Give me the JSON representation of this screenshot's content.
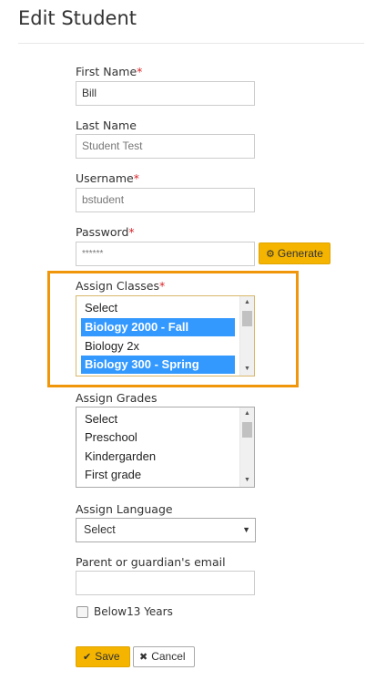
{
  "page": {
    "title": "Edit Student"
  },
  "first_name": {
    "label": "First Name",
    "required": "*",
    "value": "Bill"
  },
  "last_name": {
    "label": "Last Name",
    "value": "Student Test"
  },
  "username": {
    "label": "Username",
    "required": "*",
    "value": "bstudent"
  },
  "password": {
    "label": "Password",
    "required": "*",
    "value": "******",
    "generate_label": "Generate",
    "generate_icon": "gear-icon"
  },
  "assign_classes": {
    "label": "Assign Classes",
    "required": "*",
    "options": [
      {
        "text": "Select",
        "selected": false
      },
      {
        "text": "Biology 2000 - Fall",
        "selected": true
      },
      {
        "text": "Biology 2x",
        "selected": false
      },
      {
        "text": "Biology 300 - Spring",
        "selected": true
      }
    ],
    "highlight_color": "#f0960a"
  },
  "assign_grades": {
    "label": "Assign Grades",
    "options": [
      "Select",
      "Preschool",
      "Kindergarden",
      "First grade"
    ]
  },
  "assign_language": {
    "label": "Assign Language",
    "selected": "Select"
  },
  "guardian_email": {
    "label": "Parent or guardian's email",
    "value": ""
  },
  "below13": {
    "label": "Below13 Years",
    "checked": false
  },
  "actions": {
    "save_label": "Save",
    "save_icon": "check-icon",
    "cancel_label": "Cancel",
    "cancel_icon": "close-icon"
  },
  "colors": {
    "accent": "#f4b400",
    "selection": "#3399ff",
    "required": "#d9262b"
  }
}
